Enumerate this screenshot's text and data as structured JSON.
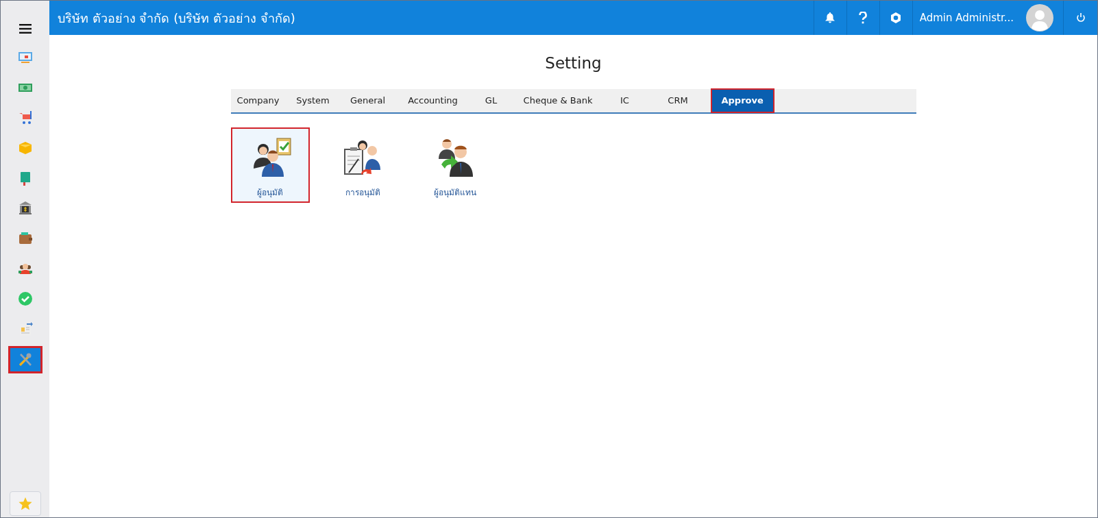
{
  "header": {
    "company": "บริษัท ตัวอย่าง จำกัด (บริษัท ตัวอย่าง จำกัด)",
    "user": "Admin Administr..."
  },
  "sidebar": {
    "items": [
      {
        "kind": "monitor",
        "selected": false
      },
      {
        "kind": "money",
        "selected": false
      },
      {
        "kind": "cart",
        "selected": false
      },
      {
        "kind": "box",
        "selected": false
      },
      {
        "kind": "book",
        "selected": false
      },
      {
        "kind": "bank",
        "selected": false
      },
      {
        "kind": "wallet",
        "selected": false
      },
      {
        "kind": "people",
        "selected": false
      },
      {
        "kind": "check",
        "selected": false
      },
      {
        "kind": "invoice",
        "selected": false
      },
      {
        "kind": "tools",
        "selected": true
      }
    ]
  },
  "page": {
    "title": "Setting"
  },
  "tabs": [
    {
      "label": "Company",
      "selected": false
    },
    {
      "label": "System",
      "selected": false
    },
    {
      "label": "General",
      "selected": false
    },
    {
      "label": "Accounting",
      "selected": false
    },
    {
      "label": "GL",
      "selected": false
    },
    {
      "label": "Cheque & Bank",
      "selected": false
    },
    {
      "label": "IC",
      "selected": false
    },
    {
      "label": "CRM",
      "selected": false
    },
    {
      "label": "Approve",
      "selected": true
    }
  ],
  "tiles": [
    {
      "kind": "approver",
      "label": "ผู้อนุมัติ",
      "selected": true
    },
    {
      "kind": "approval",
      "label": "การอนุมัติ",
      "selected": false
    },
    {
      "kind": "substitute",
      "label": "ผู้อนุมัติแทน",
      "selected": false
    }
  ]
}
